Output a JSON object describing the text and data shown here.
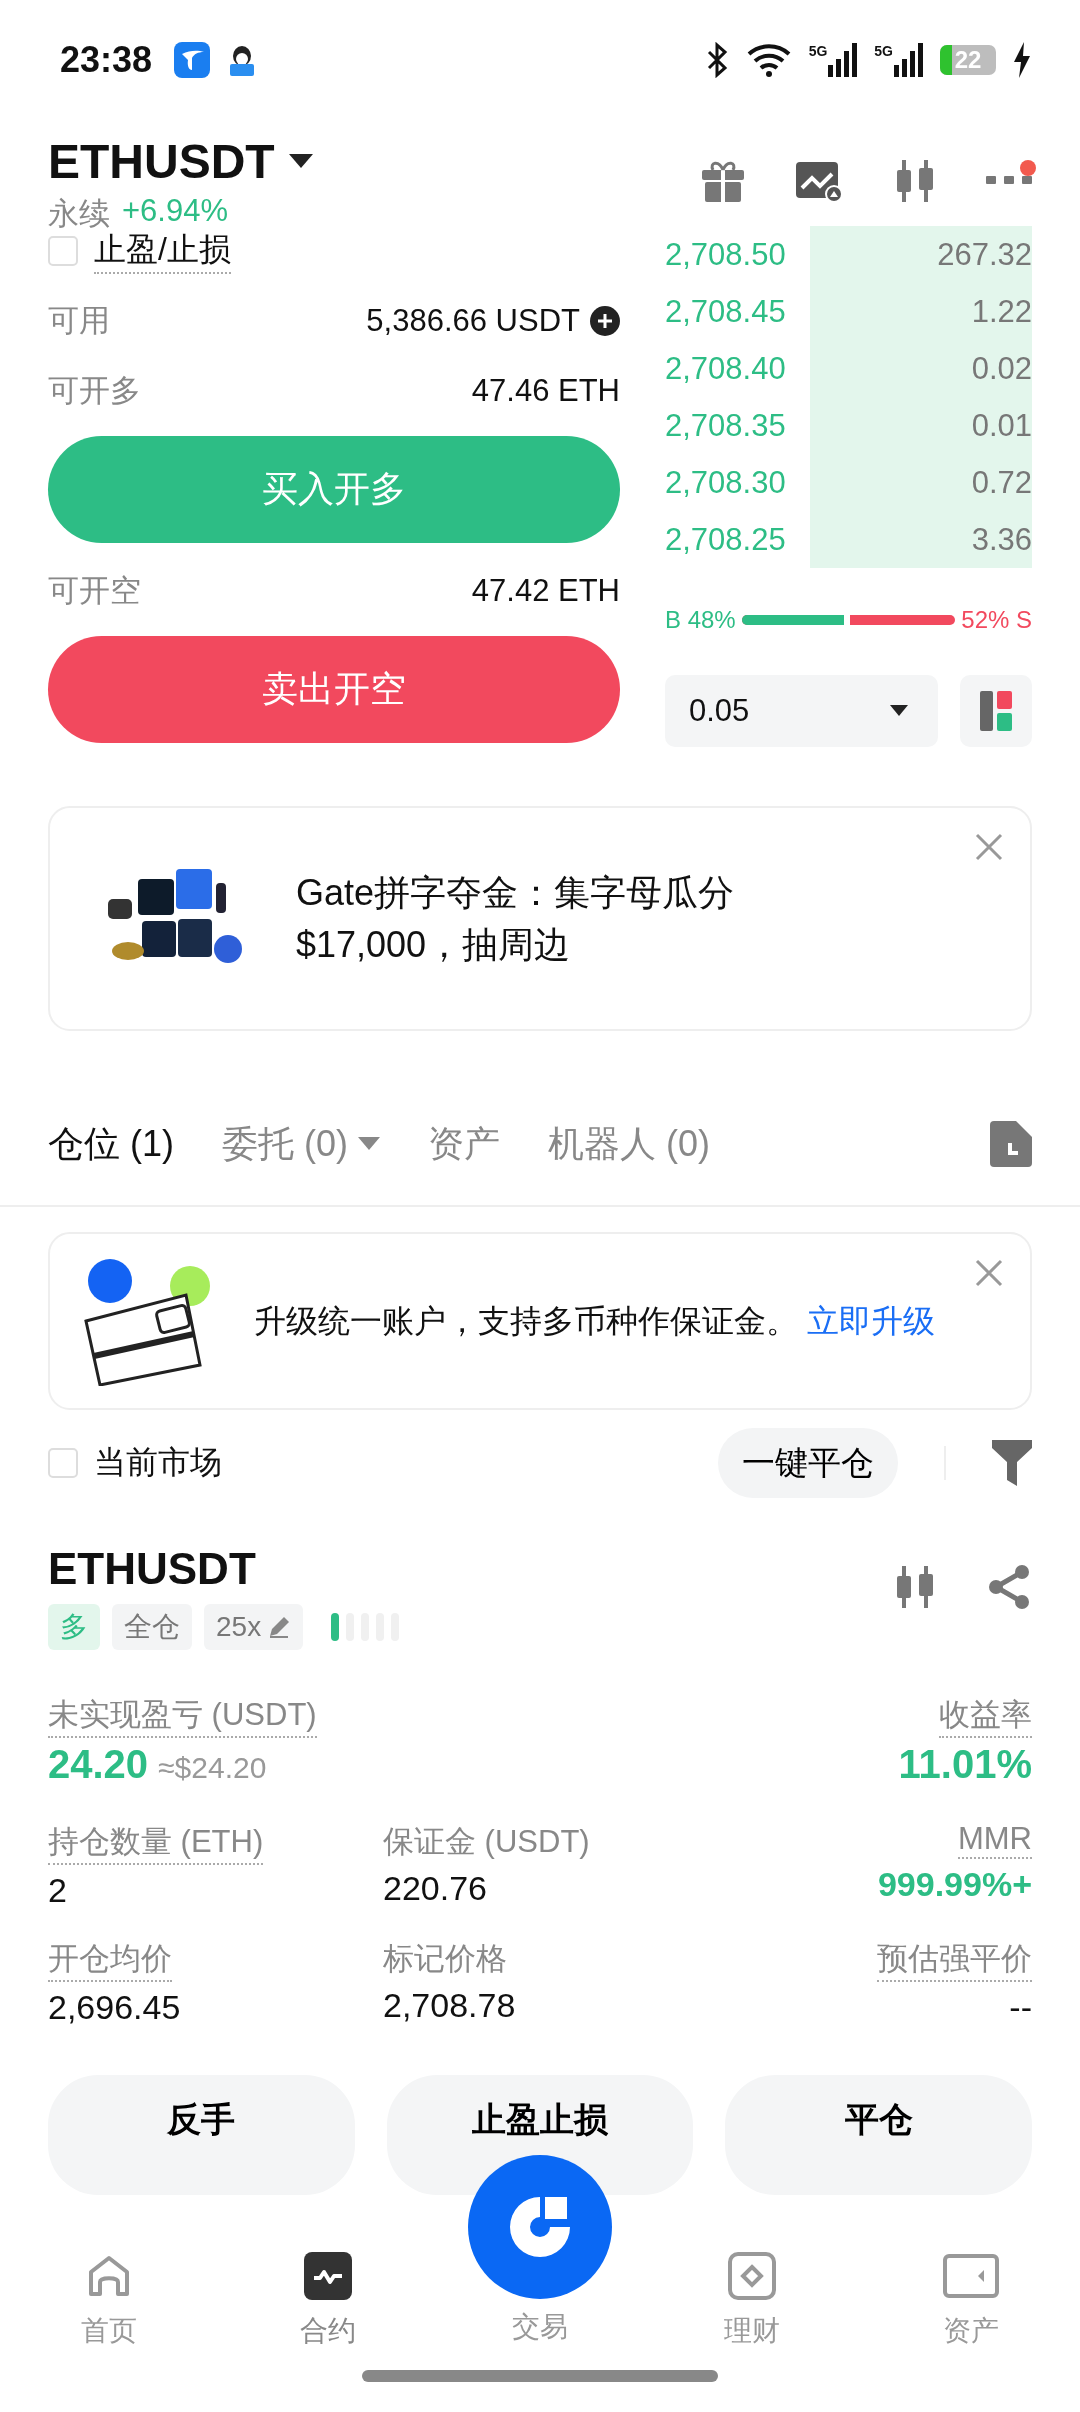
{
  "status_bar": {
    "time": "23:38",
    "network_1": "5G",
    "network_2": "5G",
    "battery": "22"
  },
  "header": {
    "symbol": "ETHUSDT",
    "type": "永续",
    "change": "+6.94%"
  },
  "order_form": {
    "tp_sl": {
      "label": "止盈/止损",
      "checked": false
    },
    "available": {
      "label": "可用",
      "value": "5,386.66 USDT"
    },
    "max_long": {
      "label": "可开多",
      "value": "47.46 ETH"
    },
    "buy_button": "买入开多",
    "max_short": {
      "label": "可开空",
      "value": "47.42 ETH"
    },
    "sell_button": "卖出开空"
  },
  "order_book": {
    "rows": [
      {
        "price": "2,708.50",
        "amount": "267.32"
      },
      {
        "price": "2,708.45",
        "amount": "1.22"
      },
      {
        "price": "2,708.40",
        "amount": "0.02"
      },
      {
        "price": "2,708.35",
        "amount": "0.01"
      },
      {
        "price": "2,708.30",
        "amount": "0.72"
      },
      {
        "price": "2,708.25",
        "amount": "3.36"
      }
    ],
    "ratio": {
      "buy_label": "B 48%",
      "sell_label": "52% S",
      "level": 0.48
    },
    "precision": "0.05"
  },
  "promo": {
    "lines": [
      "Gate拼字夺金：集字母瓜分",
      "$17,000，抽周边"
    ]
  },
  "tabs": [
    {
      "label": "仓位 (1)",
      "selected": true,
      "dropdown": false
    },
    {
      "label": "委托 (0)",
      "selected": false,
      "dropdown": true
    },
    {
      "label": "资产",
      "selected": false,
      "dropdown": false
    },
    {
      "label": "机器人 (0)",
      "selected": false,
      "dropdown": false
    }
  ],
  "upgrade_banner": {
    "text": "升级统一账户，支持多币种作保证金。",
    "link": "立即升级"
  },
  "filter": {
    "current_market": {
      "label": "当前市场",
      "checked": false
    },
    "close_all": "一键平仓"
  },
  "position": {
    "symbol": "ETHUSDT",
    "tags": [
      {
        "label": "多",
        "kind": "side"
      },
      {
        "label": "全仓",
        "kind": "plain"
      },
      {
        "label": "25x",
        "kind": "editable"
      }
    ],
    "pnl": {
      "label": "未实现盈亏 (USDT)",
      "value": "24.20",
      "approx": "≈$24.20"
    },
    "roe": {
      "label": "收益率",
      "value": "11.01%"
    },
    "metrics": [
      {
        "label": "持仓数量 (ETH)",
        "value": "2",
        "kind": "plain",
        "dotted": true
      },
      {
        "label": "保证金 (USDT)",
        "value": "220.76",
        "kind": "plain",
        "dotted": false
      },
      {
        "label": "MMR",
        "value": "999.99%+",
        "kind": "positive",
        "dotted": true
      },
      {
        "label": "开仓均价",
        "value": "2,696.45",
        "kind": "plain",
        "dotted": true
      },
      {
        "label": "标记价格",
        "value": "2,708.78",
        "kind": "plain",
        "dotted": false
      },
      {
        "label": "预估强平价",
        "value": "--",
        "kind": "plain",
        "dotted": true
      }
    ],
    "actions": [
      "反手",
      "止盈止损",
      "平仓"
    ]
  },
  "nav": [
    {
      "label": "首页",
      "kind": "home",
      "selected": false
    },
    {
      "label": "合约",
      "kind": "futures",
      "selected": true
    },
    {
      "label": "交易",
      "kind": "trade",
      "selected": false
    },
    {
      "label": "理财",
      "kind": "earn",
      "selected": false
    },
    {
      "label": "资产",
      "kind": "assets",
      "selected": false
    }
  ]
}
